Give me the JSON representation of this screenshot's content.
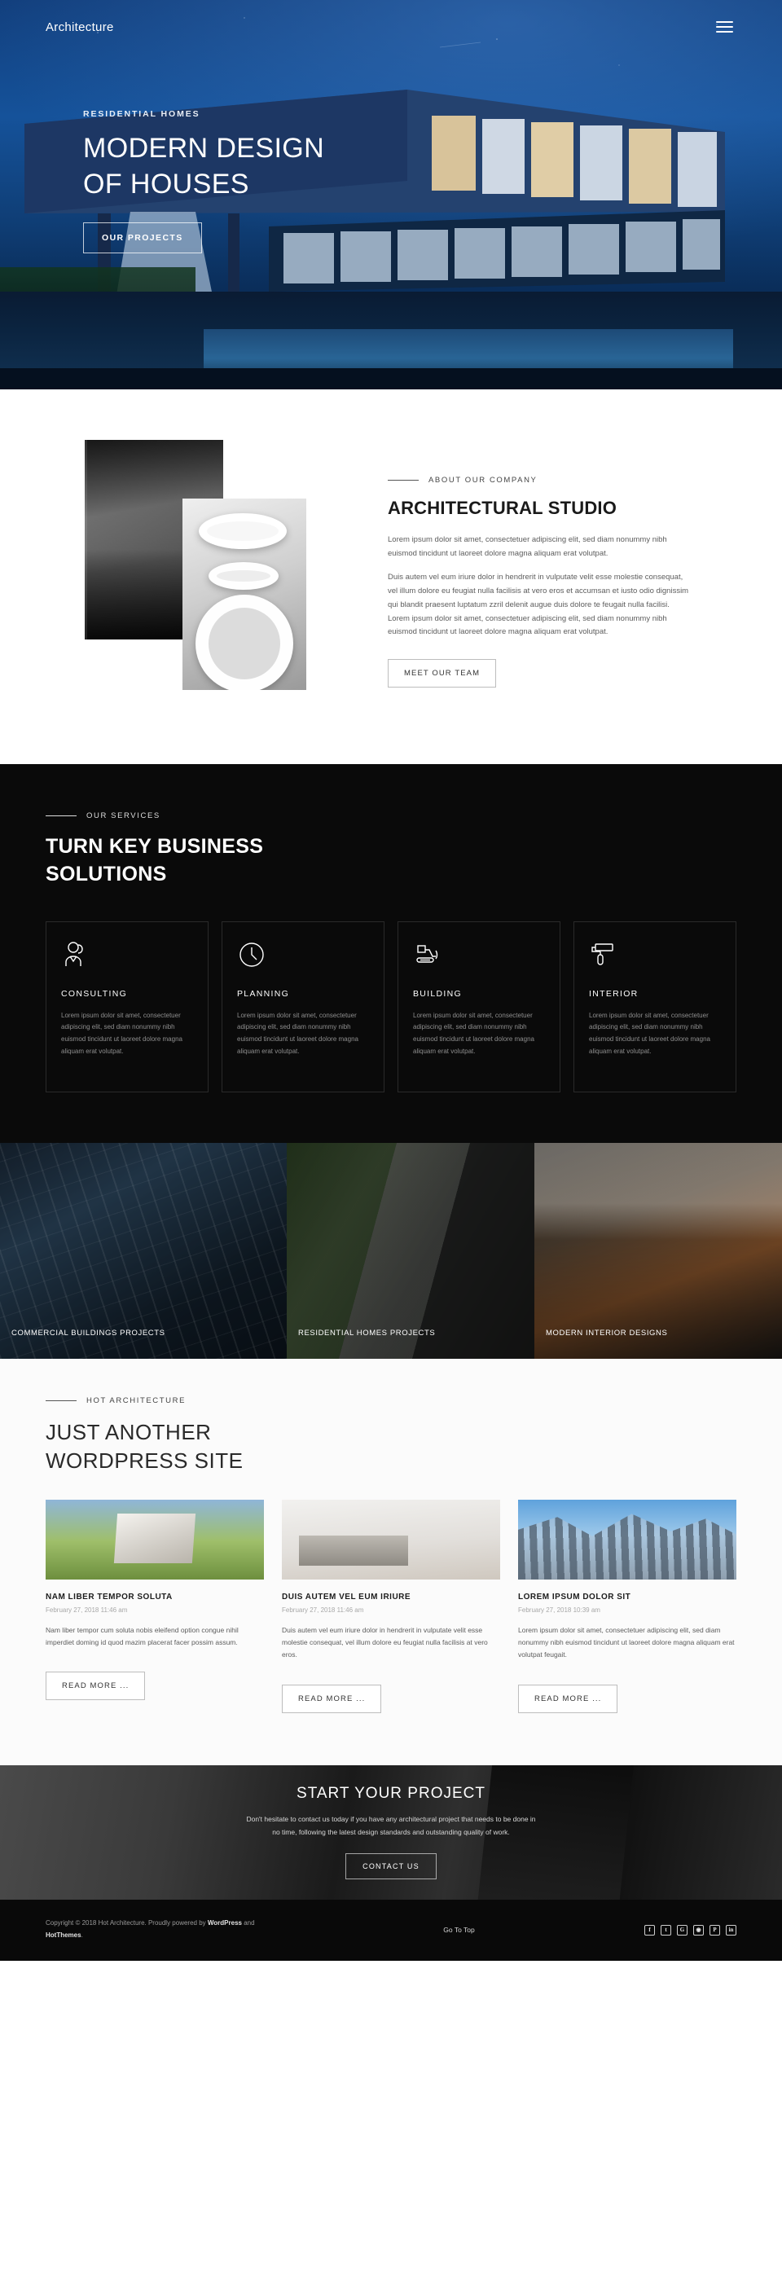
{
  "header": {
    "logo": "Architecture",
    "menu_icon": "hamburger-menu-icon"
  },
  "hero": {
    "eyebrow": "RESIDENTIAL HOMES",
    "title_line1": "MODERN DESIGN",
    "title_line2": "OF HOUSES",
    "cta_label": "OUR PROJECTS"
  },
  "about": {
    "eyebrow": "ABOUT OUR COMPANY",
    "heading": "ARCHITECTURAL STUDIO",
    "paragraph1": "Lorem ipsum dolor sit amet, consectetuer adipiscing elit, sed diam nonummy nibh euismod tincidunt ut laoreet dolore magna aliquam erat volutpat.",
    "paragraph2": "Duis autem vel eum iriure dolor in hendrerit in vulputate velit esse molestie consequat, vel illum dolore eu feugiat nulla facilisis at vero eros et accumsan et iusto odio dignissim qui blandit praesent luptatum zzril delenit augue duis dolore te feugait nulla facilisi. Lorem ipsum dolor sit amet, consectetuer adipiscing elit, sed diam nonummy nibh euismod tincidunt ut laoreet dolore magna aliquam erat volutpat.",
    "button_label": "MEET OUR TEAM"
  },
  "services": {
    "eyebrow": "OUR SERVICES",
    "heading_line1": "TURN KEY BUSINESS",
    "heading_line2": "SOLUTIONS",
    "cards": [
      {
        "icon": "consultant-person-icon",
        "title": "CONSULTING",
        "desc": "Lorem ipsum dolor sit amet, consectetuer adipiscing elit, sed diam nonummy nibh euismod tincidunt ut laoreet dolore magna aliquam erat volutpat."
      },
      {
        "icon": "clock-icon",
        "title": "PLANNING",
        "desc": "Lorem ipsum dolor sit amet, consectetuer adipiscing elit, sed diam nonummy nibh euismod tincidunt ut laoreet dolore magna aliquam erat volutpat."
      },
      {
        "icon": "bulldozer-icon",
        "title": "BUILDING",
        "desc": "Lorem ipsum dolor sit amet, consectetuer adipiscing elit, sed diam nonummy nibh euismod tincidunt ut laoreet dolore magna aliquam erat volutpat."
      },
      {
        "icon": "paint-roller-icon",
        "title": "INTERIOR",
        "desc": "Lorem ipsum dolor sit amet, consectetuer adipiscing elit, sed diam nonummy nibh euismod tincidunt ut laoreet dolore magna aliquam erat volutpat."
      }
    ]
  },
  "gallery": {
    "items": [
      {
        "caption": "COMMERCIAL BUILDINGS PROJECTS"
      },
      {
        "caption": "RESIDENTIAL HOMES PROJECTS"
      },
      {
        "caption": "MODERN INTERIOR DESIGNS"
      }
    ]
  },
  "blog": {
    "eyebrow": "HOT ARCHITECTURE",
    "heading_line1": "JUST ANOTHER",
    "heading_line2": "WORDPRESS SITE",
    "read_more_label": "READ MORE ...",
    "posts": [
      {
        "title": "NAM LIBER TEMPOR SOLUTA",
        "date": "February 27, 2018 11:46 am",
        "excerpt": "Nam liber tempor cum soluta nobis eleifend option congue nihil imperdiet doming id quod mazim placerat facer possim assum."
      },
      {
        "title": "DUIS AUTEM VEL EUM IRIURE",
        "date": "February 27, 2018 11:46 am",
        "excerpt": "Duis autem vel eum iriure dolor in hendrerit in vulputate velit esse molestie consequat, vel illum dolore eu feugiat nulla facilisis at vero eros."
      },
      {
        "title": "LOREM IPSUM DOLOR SIT",
        "date": "February 27, 2018 10:39 am",
        "excerpt": "Lorem ipsum dolor sit amet, consectetuer adipiscing elit, sed diam nonummy nibh euismod tincidunt ut laoreet dolore magna aliquam erat volutpat feugait."
      }
    ]
  },
  "cta": {
    "title": "START YOUR PROJECT",
    "text": "Don't hesitate to contact us today if you have any architectural project that needs to be done in no time, following the latest design standards and outstanding quality of work.",
    "button_label": "CONTACT US"
  },
  "footer": {
    "copyright_part1": "Copyright © 2018 Hot Architecture. Proudly powered by ",
    "copyright_wordpress": "WordPress",
    "copyright_and": " and ",
    "copyright_hotthemes": "HotThemes",
    "copyright_end": ".",
    "go_to_top": "Go To Top",
    "socials": [
      {
        "name": "facebook-icon",
        "glyph": "f"
      },
      {
        "name": "twitter-icon",
        "glyph": "t"
      },
      {
        "name": "google-plus-icon",
        "glyph": "G"
      },
      {
        "name": "instagram-icon",
        "glyph": "◉"
      },
      {
        "name": "pinterest-icon",
        "glyph": "P"
      },
      {
        "name": "linkedin-icon",
        "glyph": "in"
      }
    ]
  },
  "colors": {
    "hero_blue": "#15529a",
    "dark": "#0a0a0a",
    "accent_text": "#ffffff"
  }
}
